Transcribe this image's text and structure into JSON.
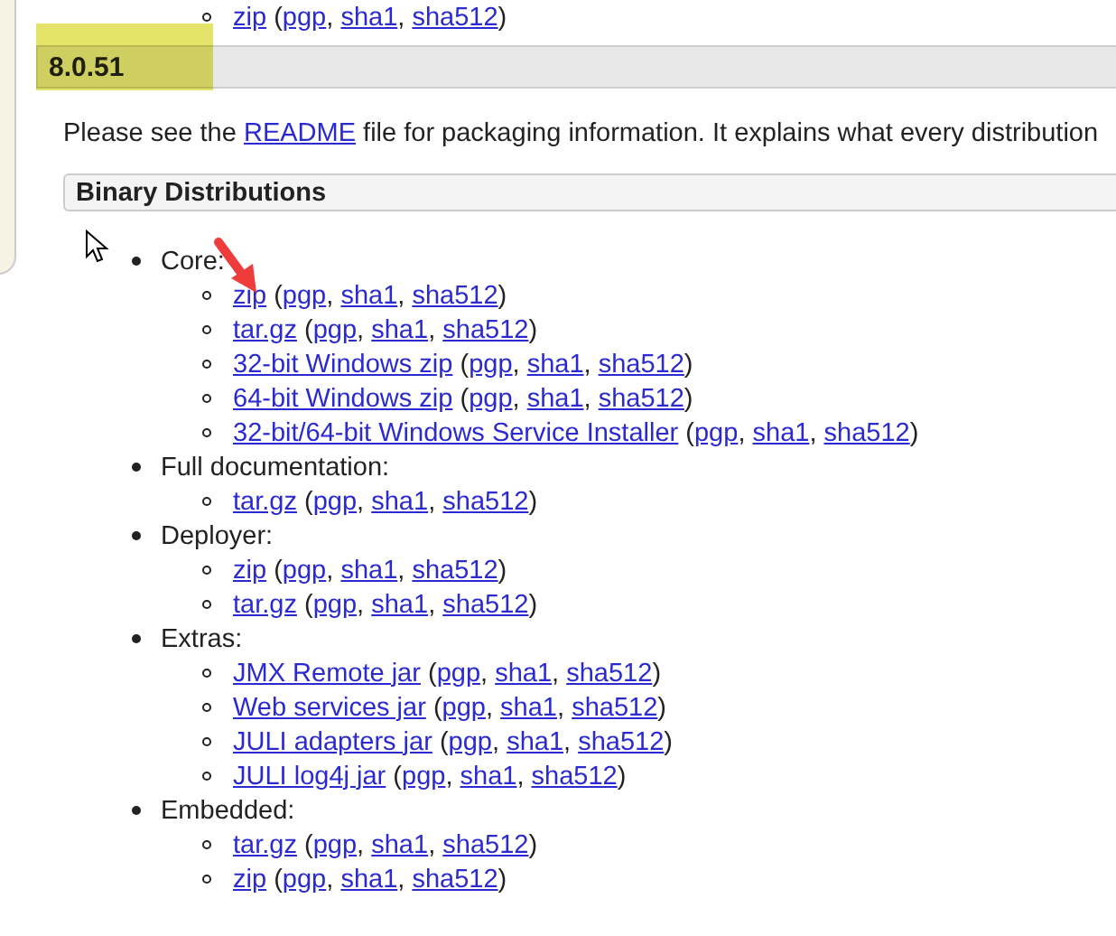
{
  "punctuation": {
    "open": "(",
    "separator": ",",
    "close": ")"
  },
  "previous_item": {
    "name": "zip",
    "signatures": [
      "pgp",
      "sha1",
      "sha512"
    ]
  },
  "version": "8.0.51",
  "intro": {
    "before": "Please see the",
    "link": "README",
    "after": "file for packaging information. It explains what every distribution"
  },
  "section_title": "Binary Distributions",
  "groups": [
    {
      "label": "Core:",
      "items": [
        {
          "name": "zip",
          "signatures": [
            "pgp",
            "sha1",
            "sha512"
          ]
        },
        {
          "name": "tar.gz",
          "signatures": [
            "pgp",
            "sha1",
            "sha512"
          ]
        },
        {
          "name": "32-bit Windows zip",
          "signatures": [
            "pgp",
            "sha1",
            "sha512"
          ]
        },
        {
          "name": "64-bit Windows zip",
          "signatures": [
            "pgp",
            "sha1",
            "sha512"
          ]
        },
        {
          "name": "32-bit/64-bit Windows Service Installer",
          "signatures": [
            "pgp",
            "sha1",
            "sha512"
          ]
        }
      ]
    },
    {
      "label": "Full documentation:",
      "items": [
        {
          "name": "tar.gz",
          "signatures": [
            "pgp",
            "sha1",
            "sha512"
          ]
        }
      ]
    },
    {
      "label": "Deployer:",
      "items": [
        {
          "name": "zip",
          "signatures": [
            "pgp",
            "sha1",
            "sha512"
          ]
        },
        {
          "name": "tar.gz",
          "signatures": [
            "pgp",
            "sha1",
            "sha512"
          ]
        }
      ]
    },
    {
      "label": "Extras:",
      "items": [
        {
          "name": "JMX Remote jar",
          "signatures": [
            "pgp",
            "sha1",
            "sha512"
          ]
        },
        {
          "name": "Web services jar",
          "signatures": [
            "pgp",
            "sha1",
            "sha512"
          ]
        },
        {
          "name": "JULI adapters jar",
          "signatures": [
            "pgp",
            "sha1",
            "sha512"
          ]
        },
        {
          "name": "JULI log4j jar",
          "signatures": [
            "pgp",
            "sha1",
            "sha512"
          ]
        }
      ]
    },
    {
      "label": "Embedded:",
      "items": [
        {
          "name": "tar.gz",
          "signatures": [
            "pgp",
            "sha1",
            "sha512"
          ]
        },
        {
          "name": "zip",
          "signatures": [
            "pgp",
            "sha1",
            "sha512"
          ]
        }
      ]
    }
  ]
}
